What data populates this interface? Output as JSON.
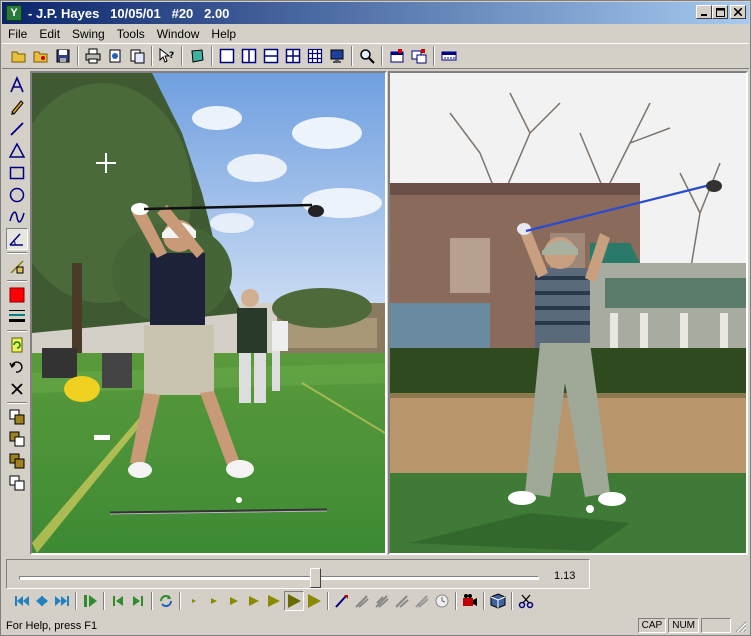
{
  "window": {
    "title": "- J.P. Hayes   10/05/01   #20   2.00",
    "app_icon_glyph": "Y"
  },
  "menu": [
    "File",
    "Edit",
    "Swing",
    "Tools",
    "Window",
    "Help"
  ],
  "toolbar": {
    "icons": [
      "open-folder-icon",
      "open-image-icon",
      "save-icon",
      "print-icon",
      "import-icon",
      "export-icon",
      "context-help-icon",
      "notes-icon",
      "layout-single-icon",
      "layout-split-vertical-icon",
      "layout-split-horizontal-icon",
      "layout-quad-icon",
      "layout-grid-icon",
      "monitor-icon",
      "zoom-icon",
      "swing-library-icon",
      "compare-icon",
      "timeline-icon"
    ]
  },
  "drawing_tools": {
    "items": [
      "text-tool-icon",
      "pencil-tool-icon",
      "line-tool-icon",
      "triangle-tool-icon",
      "rectangle-tool-icon",
      "circle-tool-icon",
      "curve-tool-icon",
      "angle-tool-icon",
      "erase-line-tool-icon",
      "color-swatch",
      "line-width-icon",
      "refresh-drawing-icon",
      "undo-icon",
      "delete-icon",
      "layer-1-icon",
      "layer-2-icon",
      "layer-3-icon",
      "layer-4-icon"
    ],
    "active_color": "#ff0000"
  },
  "timeline": {
    "position_fraction": 0.57,
    "time_value": "1.13"
  },
  "transport": {
    "buttons": [
      "first-frame-icon",
      "step-back-icon",
      "step-forward-end-icon",
      "play-pause-icon",
      "previous-key-icon",
      "next-key-icon",
      "loop-icon",
      "speed-1-icon",
      "speed-2-icon",
      "speed-3-icon",
      "speed-4-icon",
      "speed-5-icon",
      "play-forward-icon",
      "play-fast-icon",
      "draw-club-icon",
      "trace-1-icon",
      "trace-2-icon",
      "trace-3-icon",
      "trace-4-icon",
      "timer-icon",
      "record-video-icon",
      "cube-icon",
      "scissors-icon"
    ]
  },
  "status": {
    "help_text": "For Help, press F1",
    "cap": "CAP",
    "num": "NUM"
  },
  "colors": {
    "title_start": "#0a246a",
    "title_end": "#a6caf0",
    "chrome": "#d4d0c8",
    "transport_green": "#2e8b2e",
    "transport_olive": "#8a8a00"
  }
}
